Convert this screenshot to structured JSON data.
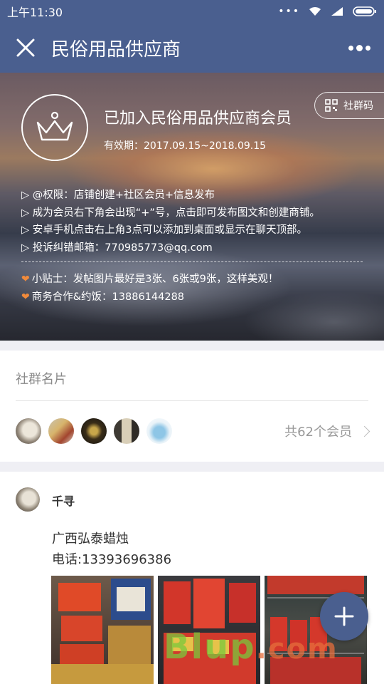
{
  "status_bar": {
    "time": "上午11:30"
  },
  "nav": {
    "title": "民俗用品供应商"
  },
  "hero": {
    "title": "已加入民俗用品供应商会员",
    "validity": "有效期：2017.09.15~2018.09.15",
    "qr_label": "社群码",
    "info_lines": [
      "▷ @权限：店铺创建+社区会员+信息发布",
      "▷ 成为会员右下角会出现“+”号，点击即可发布图文和创建商铺。",
      "▷ 安卓手机点击右上角3点可以添加到桌面或显示在聊天顶部。",
      "▷ 投诉纠错邮箱：770985773@qq.com"
    ],
    "tips": [
      "小贴士：发帖图片最好是3张、6张或9张，这样美观！",
      "商务合作&约饭：13886144288"
    ]
  },
  "card": {
    "title": "社群名片",
    "member_count": "共62个会员"
  },
  "post": {
    "author": "千寻",
    "lines": [
      "广西弘泰蜡烛",
      "电话:13393696386"
    ]
  },
  "watermark": {
    "main": "Blup",
    "suffix": ".com"
  },
  "colors": {
    "accent": "#4a5f8f",
    "heart": "#f08a3b"
  }
}
